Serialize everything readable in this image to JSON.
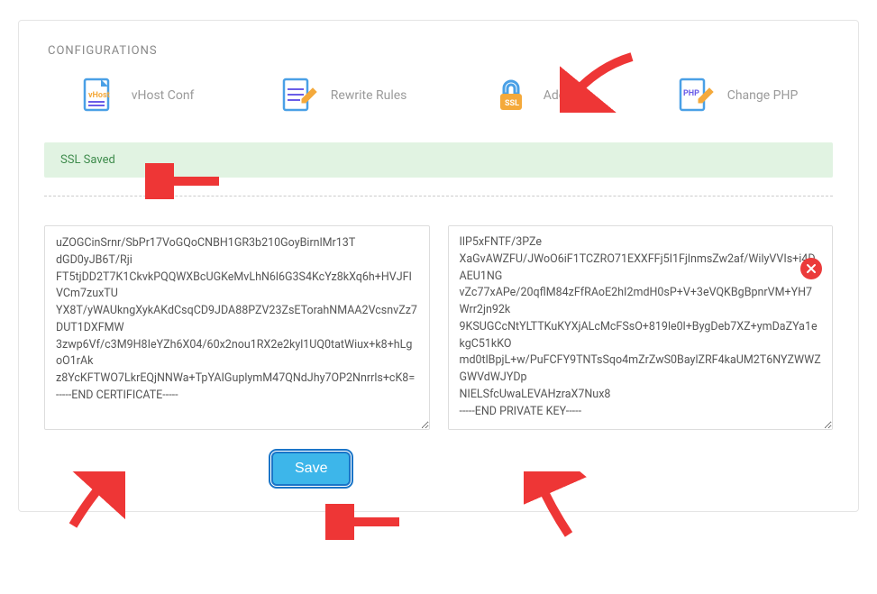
{
  "section_title": "CONFIGURATIONS",
  "configs": {
    "vhost_label": "vHost Conf",
    "rewrite_label": "Rewrite Rules",
    "addssl_label": "Add SSL",
    "changephp_label": "Change PHP"
  },
  "alert": {
    "text": "SSL Saved"
  },
  "ssl": {
    "certificate": "uZOGCinSrnr/SbPr17VoGQoCNBH1GR3b210GoyBirnlMr13T\ndGD0yJB6T/Rji\nFT5tjDD2T7K1CkvkPQQWXBcUGKeMvLhN6l6G3S4KcYz8kXq6h+HVJFIVCm7zuxTU\nYX8T/yWAUkngXykAKdCsqCD9JDA88PZV23ZsETorahNMAA2VcsnvZz7DUT1DXFMW\n3zwp6Vf/c3M9H8IeYZh6X04/60x2nou1RX2e2kyl1UQ0tatWiux+k8+hLgoO1rAk\nz8YcKFTWO7LkrEQjNNWa+TpYAIGuplymM47QNdJhy7OP2Nnrrls+cK8=\n-----END CERTIFICATE-----",
    "private_key": "IlP5xFNTF/3PZe\nXaGvAWZFU/JWoO6iF1TCZRO71EXXFFj5I1FjlnmsZw2af/WilyVVIs+i4DAEU1NG\nvZc77xAPe/20qflM84zFfRAoE2hI2mdH0sP+V+3eVQKBgBpnrVM+YH7Wrr2jn92k\n9KSUGCcNtYLTTKuKYXjALcMcFSsO+819le0l+BygDeb7XZ+ymDaZYa1ekgC51kKO\nmd0tlBpjL+w/PuFCFY9TNTsSqo4mZrZwS0BaylZRF4kaUM2T6NYZWWZGWVdWJYDp\nNIELSfcUwaLEVAHzraX7Nux8\n-----END PRIVATE KEY-----"
  },
  "buttons": {
    "save": "Save"
  },
  "icons": {
    "vhost": "vhost-conf-icon",
    "rewrite": "rewrite-rules-icon",
    "ssl": "add-ssl-icon",
    "php": "change-php-icon",
    "close": "close-icon"
  },
  "colors": {
    "accent_blue": "#4aa0e6",
    "accent_purple": "#6a5de8",
    "accent_orange": "#f4a93b",
    "success_bg": "#e1f3e2",
    "success_text": "#3f8c4d",
    "danger": "#eb3b3b",
    "arrow": "#ee3636"
  }
}
